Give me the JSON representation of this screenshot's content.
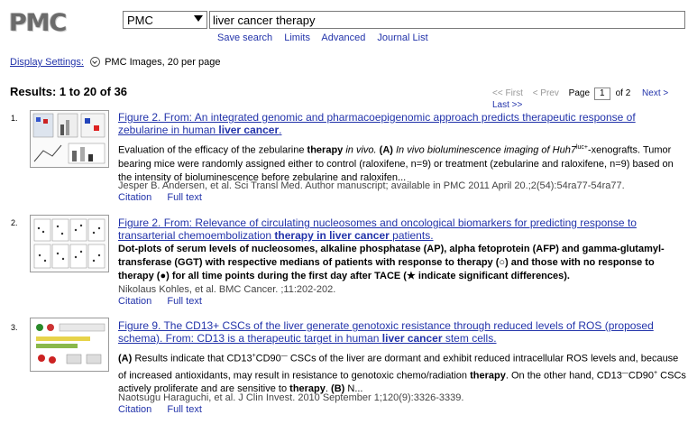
{
  "header": {
    "logo": "PMC",
    "database": "PMC",
    "query": "liver cancer therapy",
    "links": [
      "Save search",
      "Limits",
      "Advanced",
      "Journal List"
    ]
  },
  "display": {
    "settings_label": "Display Settings:",
    "settings_value": "PMC Images, 20 per page"
  },
  "results": {
    "title": "Results: 1 to 20 of 36",
    "pager": {
      "first": "<< First",
      "prev": "< Prev",
      "page_label": "Page",
      "page": "1",
      "of": "of 2",
      "next": "Next >",
      "last": "Last >>"
    }
  },
  "items": [
    {
      "num": "1.",
      "title_pre": "Figure 2. From: An integrated genomic and pharmacoepigenomic approach predicts therapeutic response of zebularine in human ",
      "title_bold": "liver cancer",
      "title_post": ".",
      "desc_1": "Evaluation of the efficacy of the zebularine ",
      "desc_1b": "therapy",
      "desc_1c": " in vivo. ",
      "desc_1d": "(A)",
      "desc_1e": " In vivo bioluminescence imaging of Huh7",
      "desc_1sup": "luc+",
      "desc_2": "-xenografts. Tumor bearing mice were randomly assigned either to control (raloxifene, n=9) or treatment (zebularine and raloxifene, n=9) based on the intensity of bioluminescence before zebularine and raloxifen...",
      "author": "Jesper B. Andersen, et al. Sci Transl Med. Author manuscript; available in PMC 2011 April 20.;2(54):54ra77-54ra77.",
      "links": [
        "Citation",
        "Full text"
      ]
    },
    {
      "num": "2.",
      "title_pre": "Figure 2. From: Relevance of circulating nucleosomes and oncological biomarkers for predicting response to transarterial chemoembolization ",
      "title_bold": "therapy in liver cancer",
      "title_post": " patients.",
      "desc_a": "Dot-plots of serum levels of nucleosomes, alkaline phosphatase (AP), alpha fetoprotein (AFP) and gamma-glutamyl-transferase (GGT) with respective medians of patients with response to ",
      "desc_a2": "therapy",
      "desc_b": " (○) and those with no response to therapy (●) for all time points during the first day after TACE (★ indicate significant differences).",
      "author": "Nikolaus Kohles, et al. BMC Cancer. ;11:202-202.",
      "links": [
        "Citation",
        "Full text"
      ]
    },
    {
      "num": "3.",
      "title_pre": "Figure 9. The CD13+ CSCs of the liver generate genotoxic resistance through reduced levels of ROS (proposed schema). From: CD13 is a therapeutic target in human ",
      "title_bold": "liver cancer",
      "title_post": " stem cells.",
      "desc_a": "(A)",
      "desc_b": " Results indicate that CD13",
      "desc_sup1": "+",
      "desc_c": "CD90",
      "desc_sup2": "—",
      "desc_d": " CSCs of the liver are dormant and exhibit reduced intracellular ROS levels and, because of increased antioxidants, may result in resistance to genotoxic chemo/radiation ",
      "desc_e": "therapy",
      "desc_f": ". On the other hand, CD13",
      "desc_sup3": "—",
      "desc_g": "CD90",
      "desc_sup4": "+",
      "desc_h": " CSCs actively proliferate and are sensitive to ",
      "desc_i": "therapy",
      "desc_j": ". ",
      "desc_k": "(B)",
      "desc_l": " N...",
      "author": "Naotsugu Haraguchi, et al. J Clin Invest. 2010 September 1;120(9):3326-3339.",
      "links": [
        "Citation",
        "Full text"
      ]
    }
  ]
}
